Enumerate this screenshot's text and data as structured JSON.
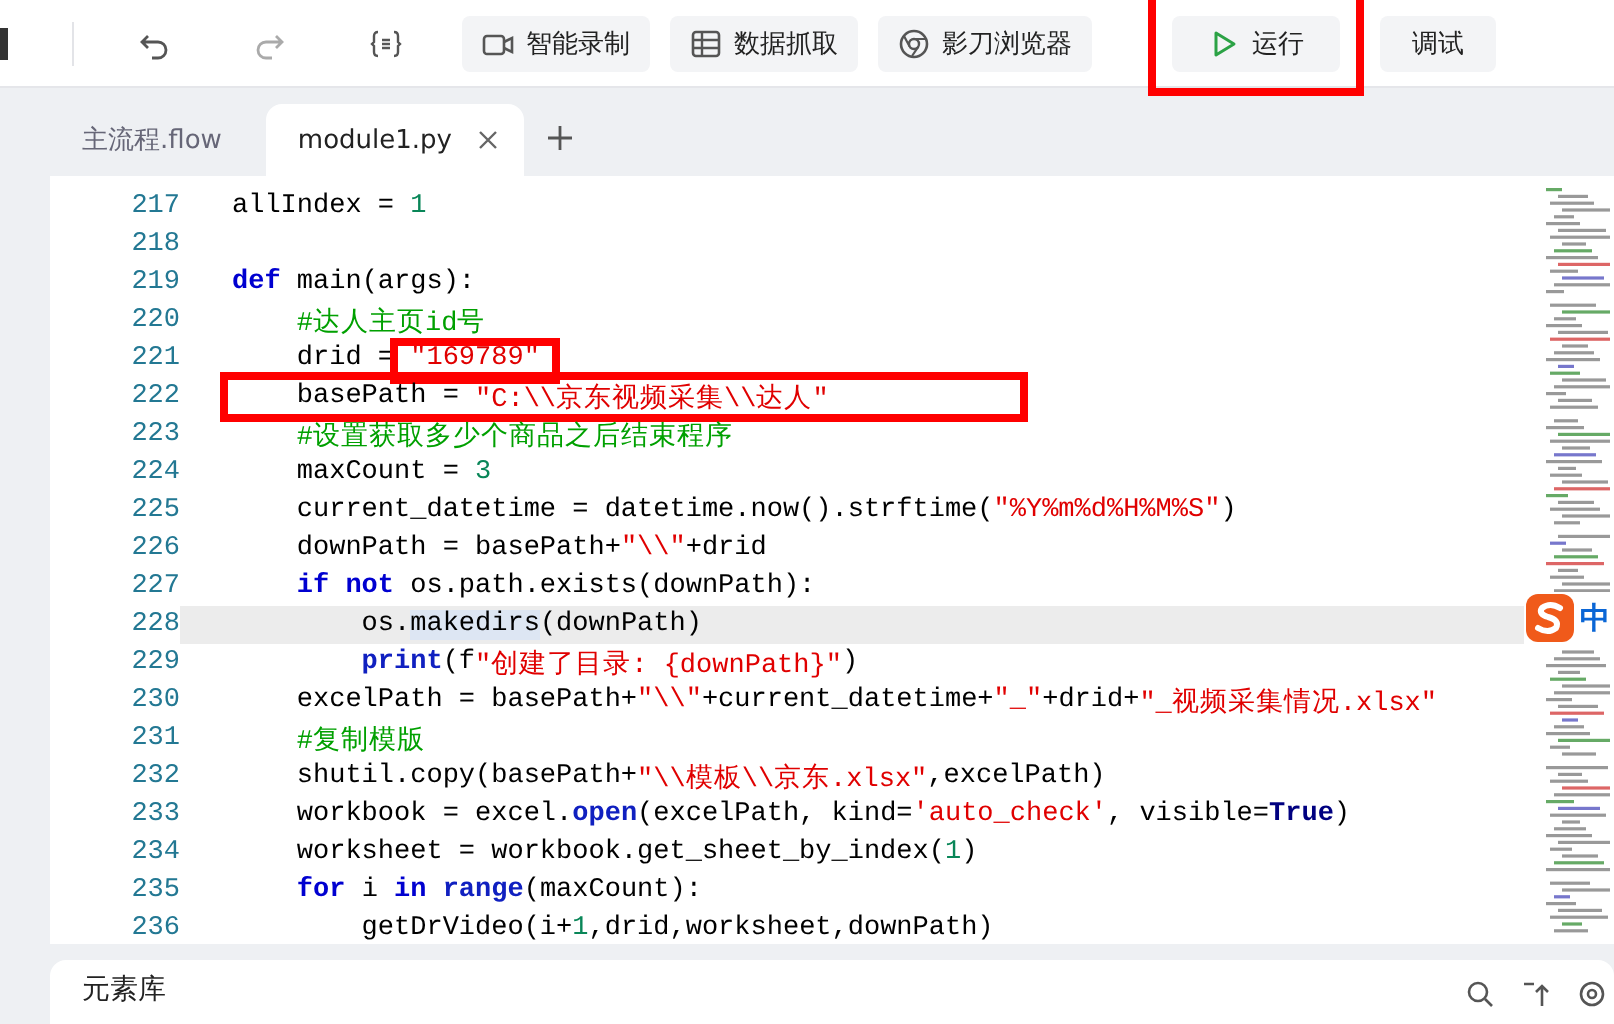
{
  "toolbar": {
    "buttons": [
      {
        "kind": "undo",
        "highlighted": false
      },
      {
        "kind": "redo",
        "highlighted": false
      },
      {
        "kind": "braces",
        "highlighted": false
      },
      {
        "kind": "record",
        "label": "智能录制",
        "highlighted": false
      },
      {
        "kind": "table",
        "label": "数据抓取",
        "highlighted": false
      },
      {
        "kind": "browser",
        "label": "影刀浏览器",
        "highlighted": false
      },
      {
        "kind": "run",
        "label": "运行",
        "highlighted": true
      },
      {
        "kind": "plain",
        "label": "调试",
        "highlighted": false
      }
    ]
  },
  "tabs": [
    {
      "label": "主流程.flow",
      "selected": false,
      "closable": false
    },
    {
      "label": "module1.py",
      "selected": true,
      "closable": true
    }
  ],
  "editor": {
    "lines": [
      {
        "number": "217",
        "tokens": [
          {
            "kind": "plain",
            "text": "allIndex = "
          },
          {
            "kind": "num",
            "text": "1"
          }
        ]
      },
      {
        "number": "218"
      },
      {
        "number": "219",
        "tokens": [
          {
            "kind": "kw",
            "text": "def"
          },
          {
            "kind": "plain",
            "text": " main(args):"
          }
        ]
      },
      {
        "number": "220",
        "tokens": [
          {
            "kind": "com",
            "text": "    #达人主页id号"
          }
        ]
      },
      {
        "number": "221",
        "tokens": [
          {
            "kind": "plain",
            "text": "    drid = "
          },
          {
            "kind": "str",
            "text": "\"169789\"",
            "highlighted": true
          }
        ]
      },
      {
        "number": "222",
        "highlighted": true,
        "tokens": [
          {
            "kind": "plain",
            "text": "    basePath = "
          },
          {
            "kind": "str",
            "text": "\"C:\\\\京东视频采集\\\\达人\""
          }
        ]
      },
      {
        "number": "223",
        "tokens": [
          {
            "kind": "com",
            "text": "    #设置获取多少个商品之后结束程序"
          }
        ]
      },
      {
        "number": "224",
        "tokens": [
          {
            "kind": "plain",
            "text": "    maxCount = "
          },
          {
            "kind": "num",
            "text": "3"
          }
        ]
      },
      {
        "number": "225",
        "tokens": [
          {
            "kind": "plain",
            "text": "    current_datetime = datetime.now().strftime("
          },
          {
            "kind": "str",
            "text": "\"%Y%m%d%H%M%S\""
          },
          {
            "kind": "plain",
            "text": ")"
          }
        ]
      },
      {
        "number": "226",
        "tokens": [
          {
            "kind": "plain",
            "text": "    downPath = basePath+"
          },
          {
            "kind": "str",
            "text": "\"\\\\\""
          },
          {
            "kind": "plain",
            "text": "+drid"
          }
        ]
      },
      {
        "number": "227",
        "tokens": [
          {
            "kind": "kw",
            "text": "    if"
          },
          {
            "kind": "kw",
            "text": " not"
          },
          {
            "kind": "plain",
            "text": " os.path.exists(downPath):"
          }
        ]
      },
      {
        "number": "228",
        "current": true,
        "tokens": [
          {
            "kind": "plain",
            "text": "        os."
          },
          {
            "kind": "match",
            "text": "makedirs"
          },
          {
            "kind": "plain",
            "text": "(downPath)"
          }
        ]
      },
      {
        "number": "229",
        "tokens": [
          {
            "kind": "builtin",
            "text": "        print"
          },
          {
            "kind": "plain",
            "text": "(f"
          },
          {
            "kind": "str",
            "text": "\"创建了目录: {downPath}\""
          },
          {
            "kind": "plain",
            "text": ")"
          }
        ]
      },
      {
        "number": "230",
        "tokens": [
          {
            "kind": "plain",
            "text": "    excelPath = basePath+"
          },
          {
            "kind": "str",
            "text": "\"\\\\\""
          },
          {
            "kind": "plain",
            "text": "+current_datetime+"
          },
          {
            "kind": "str",
            "text": "\"_\""
          },
          {
            "kind": "plain",
            "text": "+drid+"
          },
          {
            "kind": "str",
            "text": "\"_视频采集情况.xlsx\""
          }
        ]
      },
      {
        "number": "231",
        "tokens": [
          {
            "kind": "com",
            "text": "    #复制模版"
          }
        ]
      },
      {
        "number": "232",
        "tokens": [
          {
            "kind": "plain",
            "text": "    shutil.copy(basePath+"
          },
          {
            "kind": "str",
            "text": "\"\\\\模板\\\\京东.xlsx\""
          },
          {
            "kind": "plain",
            "text": ",excelPath)"
          }
        ]
      },
      {
        "number": "233",
        "tokens": [
          {
            "kind": "plain",
            "text": "    workbook = excel."
          },
          {
            "kind": "builtin",
            "text": "open"
          },
          {
            "kind": "plain",
            "text": "(excelPath, kind="
          },
          {
            "kind": "str",
            "text": "'auto_check'"
          },
          {
            "kind": "plain",
            "text": ", visible="
          },
          {
            "kind": "const",
            "text": "True"
          },
          {
            "kind": "plain",
            "text": ")"
          }
        ]
      },
      {
        "number": "234",
        "tokens": [
          {
            "kind": "plain",
            "text": "    worksheet = workbook.get_sheet_by_index("
          },
          {
            "kind": "num",
            "text": "1"
          },
          {
            "kind": "plain",
            "text": ")"
          }
        ]
      },
      {
        "number": "235",
        "tokens": [
          {
            "kind": "kw",
            "text": "    for"
          },
          {
            "kind": "plain",
            "text": " i "
          },
          {
            "kind": "kw",
            "text": "in"
          },
          {
            "kind": "builtin",
            "text": " range"
          },
          {
            "kind": "plain",
            "text": "(maxCount):"
          }
        ]
      },
      {
        "number": "236",
        "tokens": [
          {
            "kind": "plain",
            "text": "        getDrVideo(i+"
          },
          {
            "kind": "num",
            "text": "1"
          },
          {
            "kind": "plain",
            "text": ",drid,worksheet,downPath)"
          }
        ]
      }
    ]
  },
  "ime_badge": {
    "label": "中"
  },
  "bottom_panel": {
    "title": "元素库"
  }
}
